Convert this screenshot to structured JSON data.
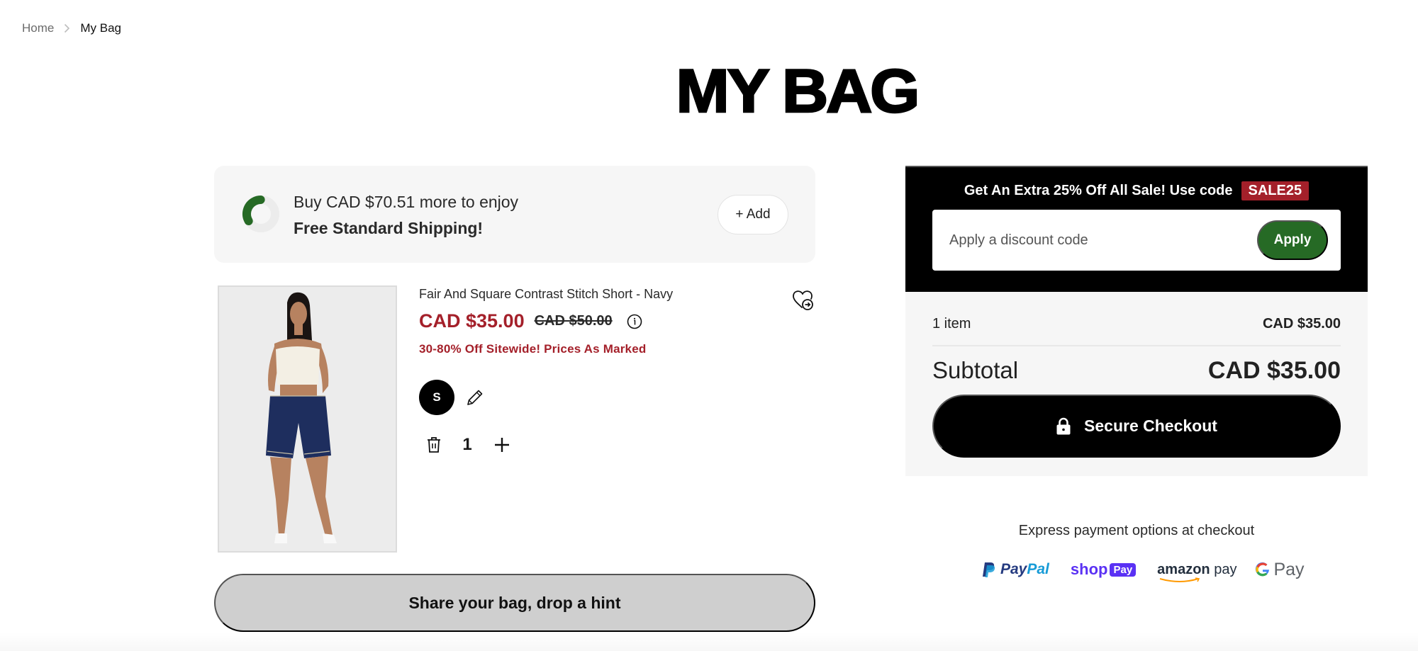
{
  "breadcrumb": {
    "items": [
      {
        "label": "Home"
      },
      {
        "label": "My Bag"
      }
    ]
  },
  "page_title": "MY BAG",
  "shipping_banner": {
    "line1": "Buy CAD $70.51 more to enjoy",
    "line2": "Free Standard Shipping!",
    "progress_fraction": 0.33,
    "add_button_label": "+ Add",
    "colors": {
      "progress": "#266a25",
      "track": "#ececec"
    }
  },
  "cart_item": {
    "name": "Fair And Square Contrast Stitch Short - Navy",
    "sale_price": "CAD $35.00",
    "original_price": "CAD $50.00",
    "promo_text": "30-80% Off Sitewide! Prices As Marked",
    "size": "S",
    "quantity": "1",
    "icons": [
      "heart-arrow-icon",
      "info-icon",
      "pencil-icon",
      "trash-icon",
      "plus-icon"
    ]
  },
  "share_button_label": "Share your bag, drop a hint",
  "promo": {
    "headline": "Get An Extra 25% Off All Sale! Use code",
    "code": "SALE25",
    "discount_placeholder": "Apply a discount code",
    "discount_value": "",
    "apply_label": "Apply"
  },
  "summary": {
    "item_count": "1 item",
    "item_total": "CAD $35.00",
    "subtotal_label": "Subtotal",
    "subtotal_value": "CAD $35.00",
    "checkout_label": "Secure Checkout"
  },
  "express": {
    "label": "Express payment options at checkout",
    "methods": {
      "paypal": {
        "pay": "Pay",
        "pal": "Pal"
      },
      "shoppay": {
        "shop": "shop",
        "pay": "Pay"
      },
      "amazonpay": {
        "amazon": "amazon",
        "pay": " pay"
      },
      "gpay": {
        "g": "G",
        "pay": "Pay"
      }
    }
  },
  "colors": {
    "sale_red": "#a4202a",
    "apply_green": "#266a25",
    "checkout_black": "#000000"
  }
}
